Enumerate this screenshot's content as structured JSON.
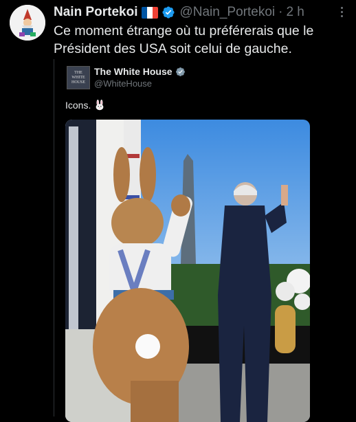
{
  "tweet": {
    "author_name": "Nain Portekoi",
    "author_handle": "@Nain_Portekoi",
    "separator": "·",
    "time": "2 h",
    "text": "Ce moment étrange où tu préférerais que le Président des USA soit celui de gauche.",
    "flag_icon": "france-flag-icon"
  },
  "quoted": {
    "author_name": "The White House",
    "author_handle": "@WhiteHouse",
    "avatar_text": "THE WHITE HOUSE",
    "text": "Icons."
  },
  "colors": {
    "background": "#000000",
    "text": "#e7e9ea",
    "muted": "#71767b",
    "verified": "#1d9bf0",
    "border": "#2f3336"
  }
}
